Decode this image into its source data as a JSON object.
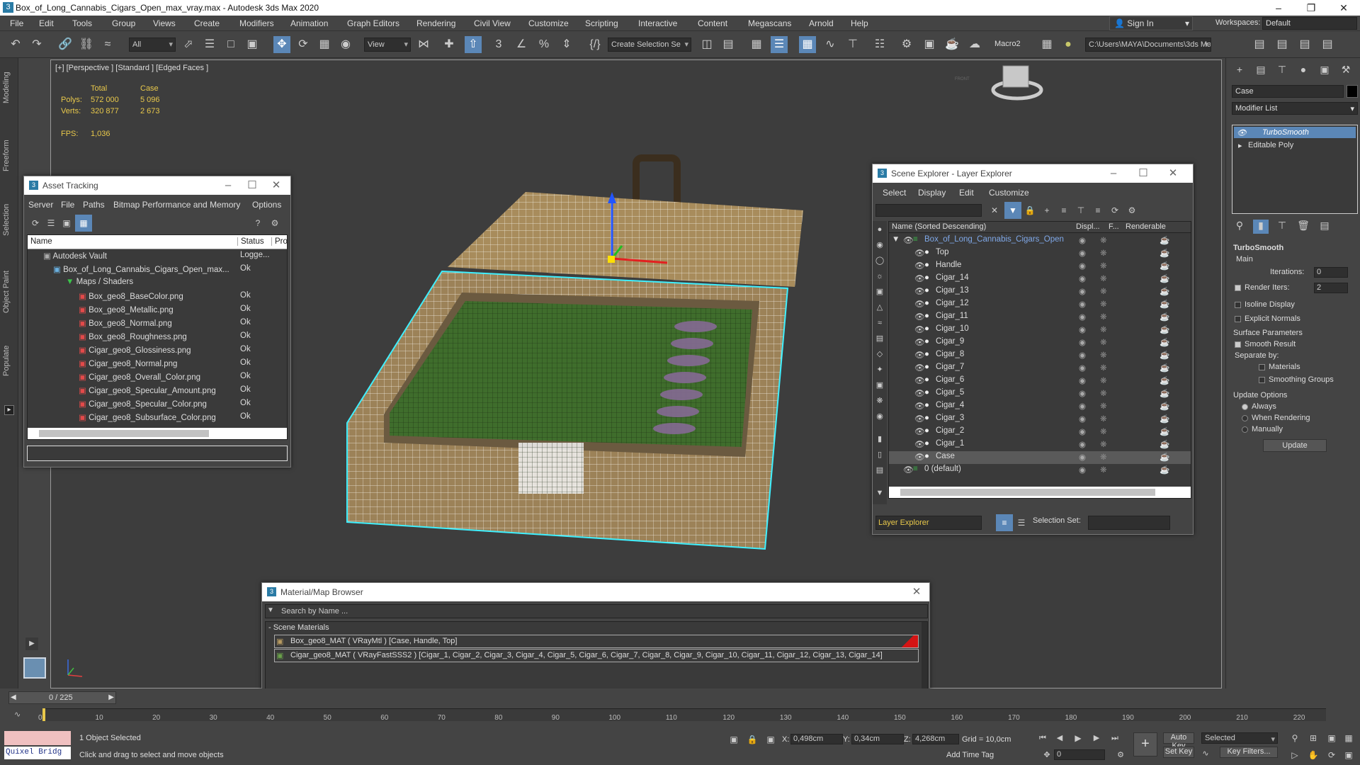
{
  "app": {
    "title": "Box_of_Long_Cannabis_Cigars_Open_max_vray.max - Autodesk 3ds Max 2020",
    "logo": "3"
  },
  "menu": [
    "File",
    "Edit",
    "Tools",
    "Group",
    "Views",
    "Create",
    "Modifiers",
    "Animation",
    "Graph Editors",
    "Rendering",
    "Civil View",
    "Customize",
    "Scripting",
    "Interactive",
    "Content",
    "Megascans",
    "Arnold",
    "Help"
  ],
  "account": {
    "signin": "Sign In",
    "workspaces_label": "Workspaces:",
    "workspace": "Default"
  },
  "toolbar": {
    "filter": "All",
    "view": "View",
    "selection_set": "Create Selection Se",
    "macro": "Macro2",
    "path": "C:\\Users\\MAYA\\Documents\\3ds Max 2020"
  },
  "left_tabs": [
    "Modeling",
    "Freeform",
    "Selection",
    "Object Paint",
    "Populate"
  ],
  "viewport": {
    "label": "[+] [Perspective ] [Standard ] [Edged Faces ]",
    "stats": {
      "h_total": "Total",
      "h_case": "Case",
      "polys_label": "Polys:",
      "polys_total": "572 000",
      "polys_case": "5 096",
      "verts_label": "Verts:",
      "verts_total": "320 877",
      "verts_case": "2 673",
      "fps_label": "FPS:",
      "fps": "1,036"
    },
    "cube": "FRONT"
  },
  "asset_tracking": {
    "title": "Asset Tracking",
    "menu": [
      "Server",
      "File",
      "Paths",
      "Bitmap Performance and Memory",
      "Options"
    ],
    "columns": [
      "Name",
      "Status",
      "Pro"
    ],
    "rows": [
      {
        "name": "Autodesk Vault",
        "status": "Logge..."
      },
      {
        "name": "Box_of_Long_Cannabis_Cigars_Open_max...",
        "status": "Ok"
      },
      {
        "name": "Maps / Shaders",
        "status": ""
      },
      {
        "name": "Box_geo8_BaseColor.png",
        "status": "Ok"
      },
      {
        "name": "Box_geo8_Metallic.png",
        "status": "Ok"
      },
      {
        "name": "Box_geo8_Normal.png",
        "status": "Ok"
      },
      {
        "name": "Box_geo8_Roughness.png",
        "status": "Ok"
      },
      {
        "name": "Cigar_geo8_Glossiness.png",
        "status": "Ok"
      },
      {
        "name": "Cigar_geo8_Normal.png",
        "status": "Ok"
      },
      {
        "name": "Cigar_geo8_Overall_Color.png",
        "status": "Ok"
      },
      {
        "name": "Cigar_geo8_Specular_Amount.png",
        "status": "Ok"
      },
      {
        "name": "Cigar_geo8_Specular_Color.png",
        "status": "Ok"
      },
      {
        "name": "Cigar_geo8_Subsurface_Color.png",
        "status": "Ok"
      }
    ]
  },
  "scene_explorer": {
    "title": "Scene Explorer - Layer Explorer",
    "menu": [
      "Select",
      "Display",
      "Edit",
      "Customize"
    ],
    "columns": [
      "Name (Sorted Descending)",
      "Displ...",
      "F...",
      "Renderable"
    ],
    "root": "Box_of_Long_Cannabis_Cigars_Open",
    "items": [
      "Top",
      "Handle",
      "Cigar_14",
      "Cigar_13",
      "Cigar_12",
      "Cigar_11",
      "Cigar_10",
      "Cigar_9",
      "Cigar_8",
      "Cigar_7",
      "Cigar_6",
      "Cigar_5",
      "Cigar_4",
      "Cigar_3",
      "Cigar_2",
      "Cigar_1",
      "Case"
    ],
    "default_layer": "0 (default)",
    "footer": "Layer Explorer",
    "selection_set_label": "Selection Set:"
  },
  "material_browser": {
    "title": "Material/Map Browser",
    "search": "Search by Name ...",
    "group": "- Scene Materials",
    "materials": [
      "Box_geo8_MAT  ( VRayMtl )  [Case, Handle, Top]",
      "Cigar_geo8_MAT  ( VRayFastSSS2 )  [Cigar_1, Cigar_2, Cigar_3, Cigar_4, Cigar_5, Cigar_6, Cigar_7, Cigar_8, Cigar_9, Cigar_10, Cigar_11, Cigar_12, Cigar_13, Cigar_14]"
    ]
  },
  "command_panel": {
    "object_name": "Case",
    "modifier_list": "Modifier List",
    "stack": [
      "TurboSmooth",
      "Editable Poly"
    ],
    "rollout": "TurboSmooth",
    "main": "Main",
    "iterations_label": "Iterations:",
    "iterations": "0",
    "render_iters_label": "Render Iters:",
    "render_iters": "2",
    "isoline": "Isoline Display",
    "explicit": "Explicit Normals",
    "surface": "Surface Parameters",
    "smooth": "Smooth Result",
    "separate": "Separate by:",
    "materials": "Materials",
    "smoothing": "Smoothing Groups",
    "update_options": "Update Options",
    "always": "Always",
    "when_rendering": "When Rendering",
    "manually": "Manually",
    "update": "Update"
  },
  "timeline": {
    "frame": "0 / 225",
    "ticks": [
      "0",
      "10",
      "20",
      "30",
      "40",
      "50",
      "60",
      "70",
      "80",
      "90",
      "100",
      "110",
      "120",
      "130",
      "140",
      "150",
      "160",
      "170",
      "180",
      "190",
      "200",
      "210",
      "220"
    ]
  },
  "status": {
    "quixel": "Quixel Bridg",
    "selected": "1 Object Selected",
    "prompt": "Click and drag to select and move objects",
    "x_label": "X:",
    "x": "0,498cm",
    "y_label": "Y:",
    "y": "0,34cm",
    "z_label": "Z:",
    "z": "4,268cm",
    "grid": "Grid = 10,0cm",
    "add_time_tag": "Add Time Tag",
    "auto_key": "Auto Key",
    "set_key": "Set Key",
    "key_mode": "Selected",
    "key_filters": "Key Filters...",
    "frame": "0"
  }
}
